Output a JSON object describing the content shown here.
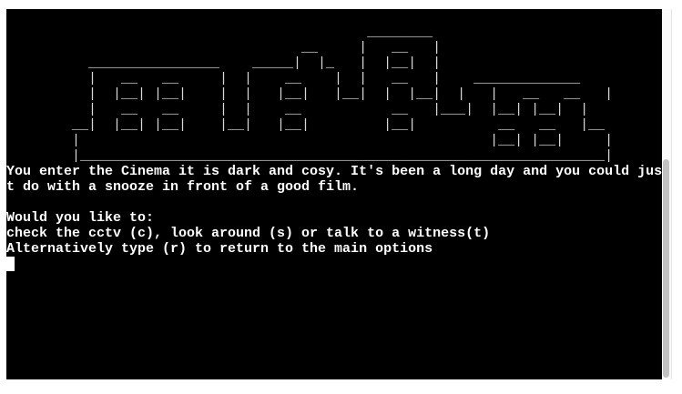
{
  "terminal": {
    "ascii_art": [
      "",
      "                                            ________",
      "                                    __     |   __   |",
      "          ________________    _____|  |_   |  |__|  |",
      "          |   __   __     |  |    __    |  |   __   |    _____________",
      "          |  |__| |__|    |  |   |__|   |__|  |  |__|  |   |   __   __   |",
      "          |   __   __     |  |    __           __   |___|  |__| |__|  |",
      "        __|  |__| |__|    |__|   |__|         |__|          __   __   |__",
      "        |                                                  |__| |__|     |",
      "        |________________________________________________________________|",
      ""
    ],
    "lines": [
      "You enter the Cinema it is dark and cosy. It's been a long day and you could jus",
      "t do with a snooze in front of a good film.",
      "",
      "Would you like to:",
      "check the cctv (c), look around (s) or talk to a witness(t)",
      "Alternatively type (r) to return to the main options"
    ]
  }
}
